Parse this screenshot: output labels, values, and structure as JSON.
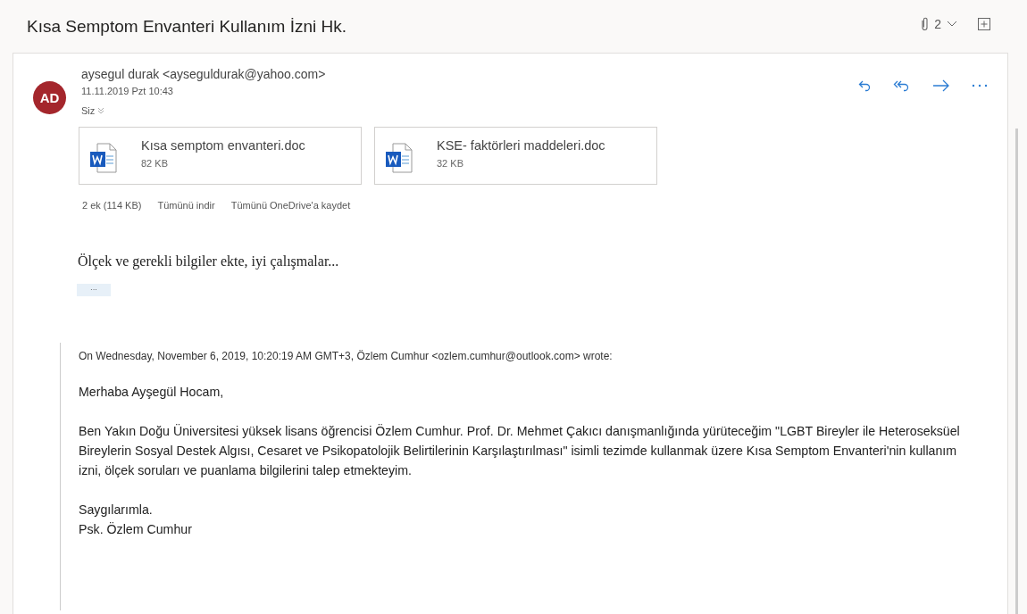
{
  "subject": "Kısa Semptom Envanteri Kullanım İzni Hk.",
  "header_actions": {
    "attachment_count": "2"
  },
  "message": {
    "avatar_initials": "AD",
    "sender": "aysegul durak <ayseguldurak@yahoo.com>",
    "date": "11.11.2019 Pzt 10:43",
    "recipients": "Siz",
    "attachments": [
      {
        "name": "Kısa semptom envanteri.doc",
        "size": "82 KB"
      },
      {
        "name": "KSE- faktörleri maddeleri.doc",
        "size": "32 KB"
      }
    ],
    "attachment_summary": "2 ek (114 KB)",
    "download_all": "Tümünü indir",
    "save_all": "Tümünü OneDrive'a kaydet",
    "body": "Ölçek ve gerekli bilgiler ekte, iyi çalışmalar...",
    "expand_label": "···",
    "quote": {
      "header": "On Wednesday, November 6, 2019, 10:20:19 AM GMT+3, Özlem Cumhur <ozlem.cumhur@outlook.com> wrote:",
      "paragraphs": [
        [
          "Merhaba Ayşegül Hocam,"
        ],
        [
          "Ben Yakın Doğu Üniversitesi yüksek lisans öğrencisi Özlem Cumhur. Prof. Dr. Mehmet Çakıcı danışmanlığında yürüteceğim \"LGBT Bireyler ile Heteroseksüel Bireylerin Sosyal Destek Algısı, Cesaret ve Psikopatolojik Belirtilerinin Karşılaştırılması\" isimli tezimde kullanmak üzere Kısa Semptom Envanteri'nin kullanım izni, ölçek soruları ve puanlama bilgilerini talep etmekteyim."
        ],
        [
          "Saygılarımla.",
          "Psk. Özlem Cumhur"
        ]
      ]
    }
  }
}
